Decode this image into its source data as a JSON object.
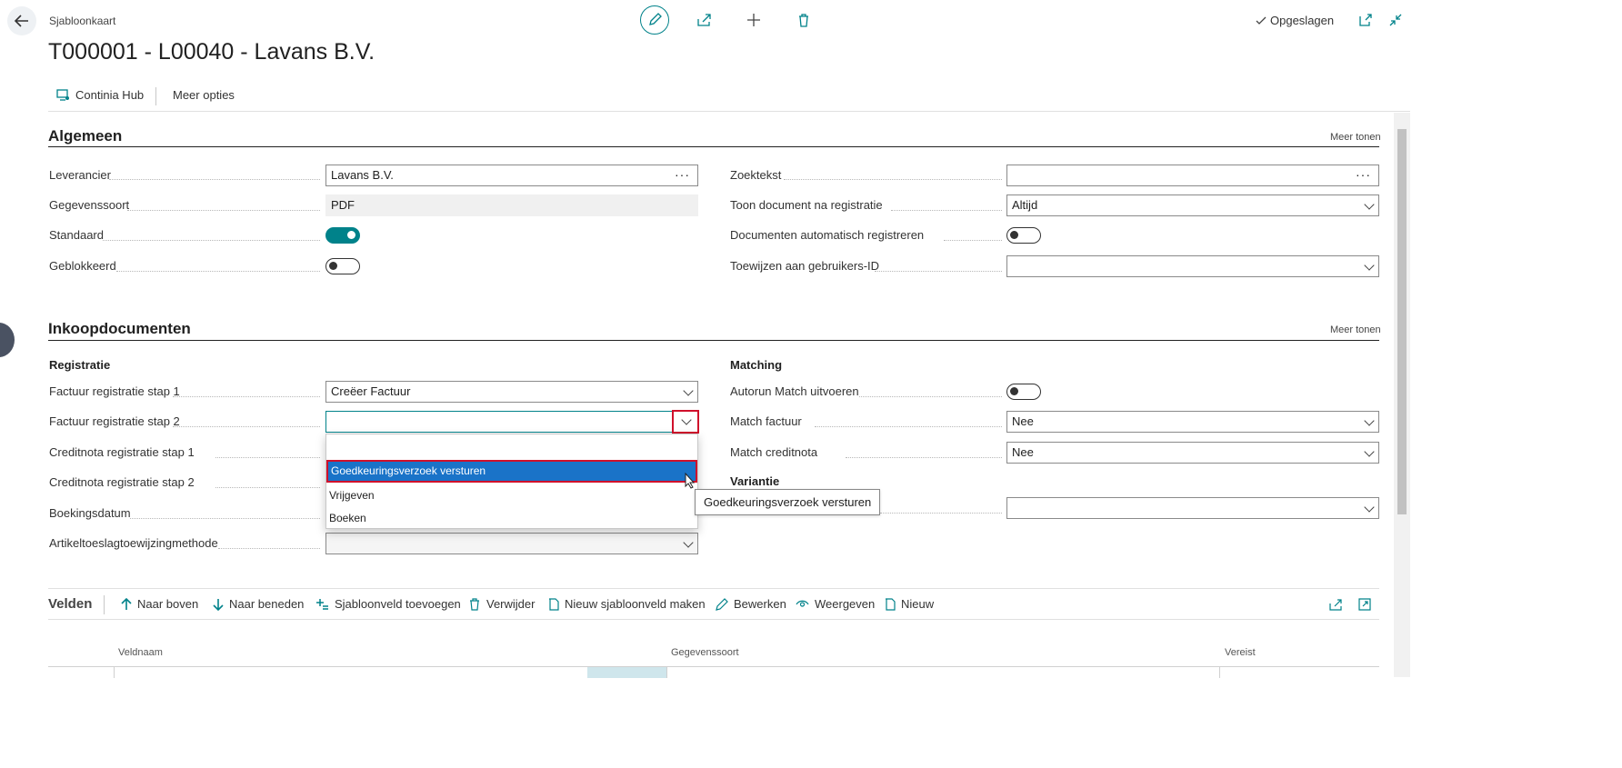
{
  "header": {
    "breadcrumb": "Sjabloonkaart",
    "title": "T000001 - L00040 - Lavans B.V.",
    "saved_status": "Opgeslagen"
  },
  "actionbar": {
    "continia_hub": "Continia Hub",
    "more_options": "Meer opties"
  },
  "algemeen": {
    "title": "Algemeen",
    "show_more": "Meer tonen",
    "leverancier_label": "Leverancier",
    "leverancier_value": "Lavans B.V.",
    "gegevenssoort_label": "Gegevenssoort",
    "gegevenssoort_value": "PDF",
    "standaard_label": "Standaard",
    "standaard_value": true,
    "geblokkeerd_label": "Geblokkeerd",
    "geblokkeerd_value": false,
    "zoektekst_label": "Zoektekst",
    "zoektekst_value": "",
    "toon_label": "Toon document na registratie",
    "toon_value": "Altijd",
    "auto_reg_label": "Documenten automatisch registreren",
    "auto_reg_value": false,
    "toewijzen_label": "Toewijzen aan gebruikers-ID",
    "toewijzen_value": ""
  },
  "inkoop": {
    "title": "Inkoopdocumenten",
    "show_more": "Meer tonen",
    "registratie_head": "Registratie",
    "fr1_label": "Factuur registratie stap 1",
    "fr1_value": "Creëer Factuur",
    "fr2_label": "Factuur registratie stap 2",
    "fr2_value": "",
    "cr1_label": "Creditnota registratie stap 1",
    "cr2_label": "Creditnota registratie stap 2",
    "boeking_label": "Boekingsdatum",
    "artikel_label": "Artikeltoeslagtoewijzingmethode",
    "matching_head": "Matching",
    "autorun_label": "Autorun Match uitvoeren",
    "autorun_value": false,
    "match_factuur_label": "Match factuur",
    "match_factuur_value": "Nee",
    "match_credit_label": "Match creditnota",
    "match_credit_value": "Nee",
    "variantie_head": "Variantie"
  },
  "dropdown": {
    "options": [
      "",
      "Goedkeuringsverzoek versturen",
      "Vrijgeven",
      "Boeken"
    ],
    "tooltip": "Goedkeuringsverzoek versturen"
  },
  "velden": {
    "title": "Velden",
    "actions": [
      "Naar boven",
      "Naar beneden",
      "Sjabloonveld toevoegen",
      "Verwijder",
      "Nieuw sjabloonveld maken",
      "Bewerken",
      "Weergeven",
      "Nieuw"
    ],
    "columns": [
      "Veldnaam",
      "Gegevenssoort",
      "Vereist"
    ]
  },
  "colors": {
    "accent": "#00828a",
    "selected": "#1a73c8",
    "highlight_border": "#d0102b"
  }
}
